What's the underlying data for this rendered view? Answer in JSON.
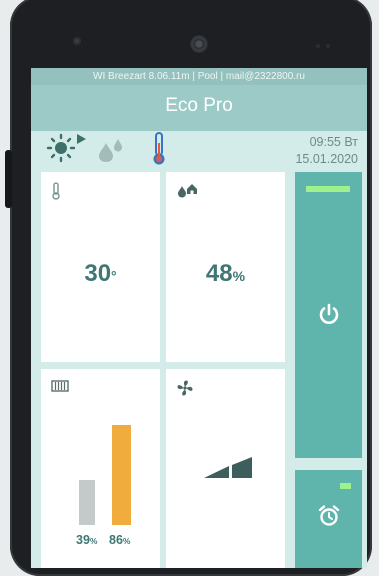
{
  "status_bar": {
    "text": "WI Breezart 8.06.11m | Pool | mail@2322800.ru"
  },
  "app_bar": {
    "title": "Eco Pro"
  },
  "weather_icons": [
    "sun-arrow-icon",
    "water-drops-icon",
    "thermometer-icon"
  ],
  "clock": {
    "time": "09:55 Вт",
    "date": "15.01.2020"
  },
  "tiles": {
    "temperature": {
      "icon": "thermometer-icon",
      "value": "30",
      "unit": "°"
    },
    "humidity": {
      "icon": "humidity-house-icon",
      "value": "48",
      "unit": "%"
    },
    "filter": {
      "icon": "filter-icon",
      "bars": [
        {
          "value": "39",
          "unit": "%",
          "color": "#c4c9ca",
          "level": 0.39
        },
        {
          "value": "86",
          "unit": "%",
          "color": "#f0ad3e",
          "level": 0.86
        }
      ]
    },
    "fan": {
      "icon": "fan-icon",
      "speed_steps_active": 2,
      "speed_steps_total": 3
    }
  },
  "power": {
    "icon": "power-icon",
    "indicator_color": "#9ef28c"
  },
  "alarm": {
    "icon": "alarm-clock-icon",
    "indicator_color": "#9ef28c"
  },
  "colors": {
    "screen_bg": "#d3ecea",
    "accent": "#5fb4ac",
    "value_text": "#3f7774"
  }
}
